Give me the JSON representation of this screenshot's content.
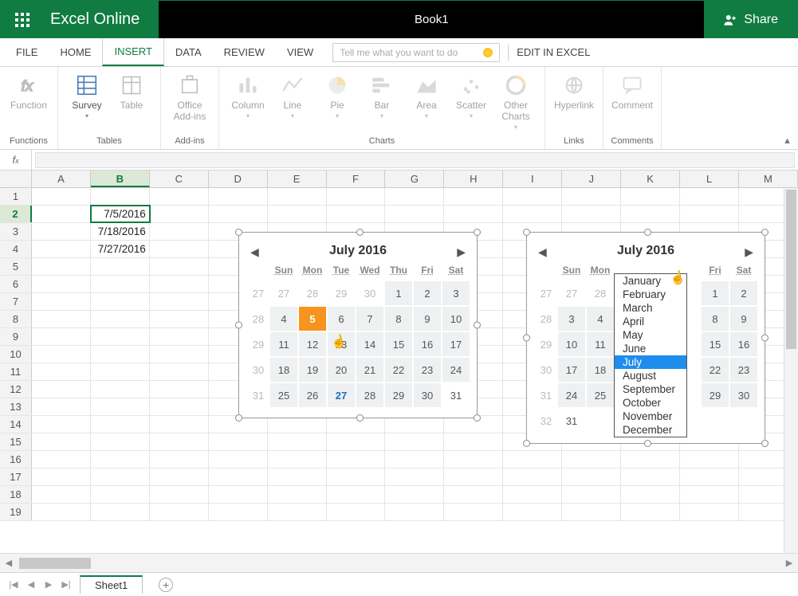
{
  "titlebar": {
    "app": "Excel Online",
    "doc": "Book1",
    "share": "Share"
  },
  "tabs": {
    "file": "FILE",
    "home": "HOME",
    "insert": "INSERT",
    "data": "DATA",
    "review": "REVIEW",
    "view": "VIEW",
    "tellme_placeholder": "Tell me what you want to do",
    "edit": "EDIT IN EXCEL"
  },
  "ribbon": {
    "functions": {
      "label": "Functions",
      "items": {
        "function": "Function"
      }
    },
    "tables": {
      "label": "Tables",
      "items": {
        "survey": "Survey",
        "table": "Table"
      }
    },
    "addins": {
      "label": "Add-ins",
      "items": {
        "office": "Office\nAdd-ins"
      }
    },
    "charts": {
      "label": "Charts",
      "items": {
        "column": "Column",
        "line": "Line",
        "pie": "Pie",
        "bar": "Bar",
        "area": "Area",
        "scatter": "Scatter",
        "other": "Other\nCharts"
      }
    },
    "links": {
      "label": "Links",
      "items": {
        "hyperlink": "Hyperlink"
      }
    },
    "comments": {
      "label": "Comments",
      "items": {
        "comment": "Comment"
      }
    }
  },
  "columns": [
    "A",
    "B",
    "C",
    "D",
    "E",
    "F",
    "G",
    "H",
    "I",
    "J",
    "K",
    "L",
    "M"
  ],
  "active_col_index": 1,
  "rows": [
    1,
    2,
    3,
    4,
    5,
    6,
    7,
    8,
    9,
    10,
    11,
    12,
    13,
    14,
    15,
    16,
    17,
    18,
    19
  ],
  "active_row_index": 1,
  "cells": {
    "B2": "7/5/2016",
    "B3": "7/18/2016",
    "B4": "7/27/2016"
  },
  "picker": {
    "title": "July 2016",
    "dow": [
      "Sun",
      "Mon",
      "Tue",
      "Wed",
      "Thu",
      "Fri",
      "Sat"
    ],
    "selected": 5,
    "today": 27,
    "days": [
      {
        "n": 27,
        "o": true
      },
      {
        "n": 28,
        "o": true
      },
      {
        "n": 29,
        "o": true
      },
      {
        "n": 30,
        "o": true
      },
      {
        "n": 1
      },
      {
        "n": 2
      },
      {
        "n": 3
      },
      {
        "n": 4
      },
      {
        "n": 5,
        "sel": true
      },
      {
        "n": 6
      },
      {
        "n": 7
      },
      {
        "n": 8
      },
      {
        "n": 9
      },
      {
        "n": 10
      },
      {
        "n": 11
      },
      {
        "n": 12
      },
      {
        "n": 13
      },
      {
        "n": 14
      },
      {
        "n": 15
      },
      {
        "n": 16
      },
      {
        "n": 17
      },
      {
        "n": 18
      },
      {
        "n": 19
      },
      {
        "n": 20
      },
      {
        "n": 21
      },
      {
        "n": 22
      },
      {
        "n": 23
      },
      {
        "n": 24
      },
      {
        "n": 25
      },
      {
        "n": 26
      },
      {
        "n": 27,
        "today": true
      },
      {
        "n": 28
      },
      {
        "n": 29
      },
      {
        "n": 30
      },
      {
        "n": 31,
        "nohl": true
      }
    ]
  },
  "picker2": {
    "title": "July 2016",
    "dow": [
      "Sun",
      "Mon",
      "",
      "",
      "",
      "Fri",
      "Sat"
    ],
    "days": [
      {
        "n": 27,
        "o": true
      },
      {
        "n": 28,
        "o": true
      },
      {
        "h": true
      },
      {
        "h": true
      },
      {
        "h": true
      },
      {
        "n": 1
      },
      {
        "n": 2
      },
      {
        "n": 3
      },
      {
        "n": 4
      },
      {
        "h": true
      },
      {
        "h": true
      },
      {
        "h": true
      },
      {
        "n": 8
      },
      {
        "n": 9
      },
      {
        "n": 10
      },
      {
        "n": 11
      },
      {
        "h": true
      },
      {
        "h": true
      },
      {
        "h": true
      },
      {
        "n": 15
      },
      {
        "n": 16
      },
      {
        "n": 17
      },
      {
        "n": 18
      },
      {
        "h": true
      },
      {
        "h": true
      },
      {
        "h": true
      },
      {
        "n": 22
      },
      {
        "n": 23
      },
      {
        "n": 24
      },
      {
        "n": 25
      },
      {
        "h": true
      },
      {
        "h": true
      },
      {
        "h": true
      },
      {
        "n": 29
      },
      {
        "n": 30
      },
      {
        "n": 31,
        "nohl": true
      }
    ]
  },
  "months": [
    "January",
    "February",
    "March",
    "April",
    "May",
    "June",
    "July",
    "August",
    "September",
    "October",
    "November",
    "December"
  ],
  "months_selected_index": 6,
  "sheet": {
    "name": "Sheet1"
  }
}
